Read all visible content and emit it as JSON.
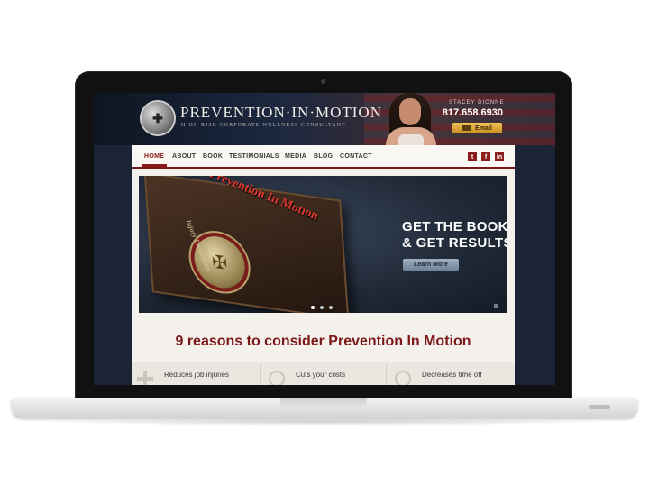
{
  "site": {
    "brand": "PREVENTION·IN·MOTION",
    "tagline": "HIGH RISK CORPORATE WELLNESS CONSULTANT",
    "contact_name": "STACEY DIONNE",
    "phone": "817.658.6930",
    "email_label": "Email"
  },
  "nav": {
    "items": [
      {
        "label": "HOME",
        "active": true
      },
      {
        "label": "ABOUT"
      },
      {
        "label": "BOOK"
      },
      {
        "label": "TESTIMONIALS"
      },
      {
        "label": "MEDIA"
      },
      {
        "label": "BLOG"
      },
      {
        "label": "CONTACT"
      }
    ],
    "social": [
      "t",
      "f",
      "in"
    ]
  },
  "slider": {
    "book_title": "Prevention In Motion",
    "book_spine": "Injury Prevention",
    "headline_line1": "GET THE BOOK",
    "headline_line2": "& GET RESULTS",
    "cta_label": "Learn More",
    "pause_label": "II",
    "slide_count": 3,
    "active_slide": 1
  },
  "main": {
    "section_title": "9 reasons to consider Prevention In Motion",
    "features": [
      {
        "label": "Reduces job injuries",
        "icon": "plus-icon"
      },
      {
        "label": "Cuts your costs",
        "icon": "clock-icon"
      },
      {
        "label": "Decreases time off",
        "icon": "clock-icon"
      }
    ]
  },
  "colors": {
    "accent": "#8c1c1c",
    "email_button": "#e0a83a",
    "header_bg": "#1c2840"
  }
}
